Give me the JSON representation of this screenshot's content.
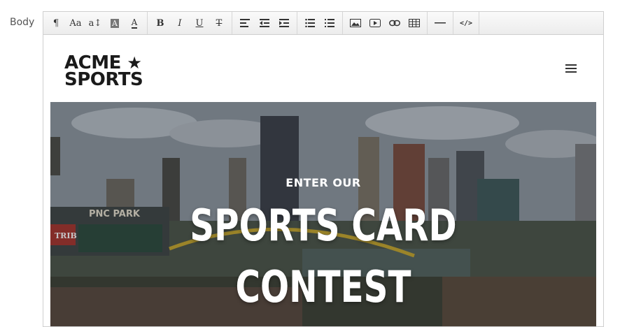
{
  "field": {
    "label": "Body"
  },
  "toolbar": {
    "groups": [
      [
        "paragraph-icon",
        "font-family-icon",
        "font-size-icon",
        "background-color-icon",
        "text-color-icon"
      ],
      [
        "bold-icon",
        "italic-icon",
        "underline-icon",
        "strikethrough-icon"
      ],
      [
        "align-icon",
        "outdent-icon",
        "indent-icon"
      ],
      [
        "bullet-list-icon",
        "numbered-list-icon"
      ],
      [
        "image-icon",
        "video-icon",
        "link-icon",
        "table-icon"
      ],
      [
        "horizontal-rule-icon"
      ],
      [
        "code-view-icon"
      ]
    ],
    "glyphs": {
      "paragraph": "¶",
      "font_family": "Aa",
      "font_size": "a↕",
      "background_color": "A",
      "text_color": "A",
      "bold": "B",
      "italic": "I",
      "underline": "U",
      "strikethrough": "T",
      "code_view": "</>"
    }
  },
  "header": {
    "logo_line1": "ACME",
    "logo_star": "★",
    "logo_line2": "SPORTS"
  },
  "hero": {
    "eyebrow": "ENTER OUR",
    "title_line1": "SPORTS CARD",
    "title_line2": "CONTEST",
    "stadium_sign": "PNC PARK",
    "board_sign": "TRIB"
  },
  "colors": {
    "toolbar_bg": "#ececec",
    "border": "#cfcfcf",
    "hero_text": "#ffffff",
    "logo_text": "#1a1a1a"
  }
}
